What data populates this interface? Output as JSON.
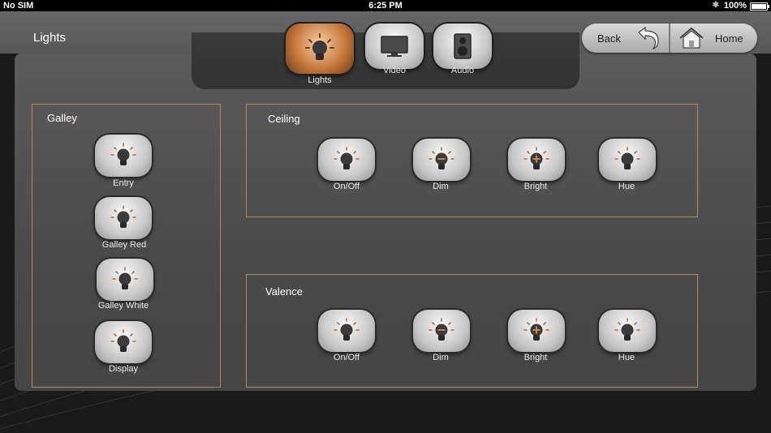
{
  "status": {
    "carrier": "No SIM",
    "time": "6:25 PM",
    "battery": "100%"
  },
  "title": "Lights",
  "nav": [
    {
      "label": "Lights",
      "icon": "lightbulb-icon",
      "active": true
    },
    {
      "label": "Video",
      "icon": "monitor-icon"
    },
    {
      "label": "Audio",
      "icon": "speaker-icon"
    }
  ],
  "back_label": "Back",
  "home_label": "Home",
  "galley": {
    "title": "Galley",
    "buttons": [
      "Entry",
      "Galley Red",
      "Galley White",
      "Display"
    ]
  },
  "ceiling": {
    "title": "Ceiling",
    "buttons": [
      "On/Off",
      "Dim",
      "Bright",
      "Hue"
    ]
  },
  "valence": {
    "title": "Valence",
    "buttons": [
      "On/Off",
      "Dim",
      "Bright",
      "Hue"
    ]
  },
  "colors": {
    "accent_orange": "#c77a3e",
    "group_border": "#b98a58"
  }
}
